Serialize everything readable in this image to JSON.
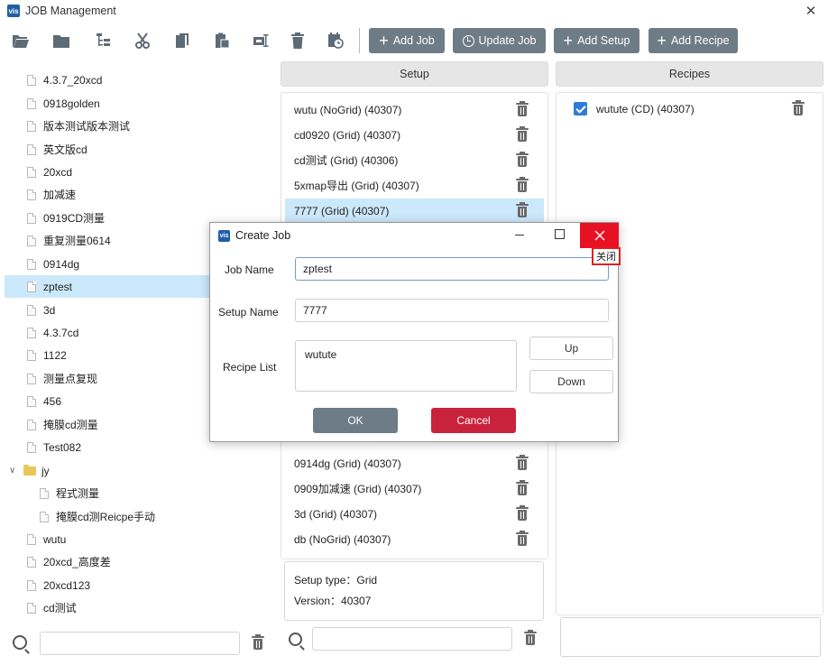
{
  "window": {
    "app_icon_text": "vis",
    "title": "JOB Management",
    "close_glyph": "✕"
  },
  "toolbar": {
    "icons": [
      "open-folder-icon",
      "folder-icon",
      "tree-structure-icon",
      "cut-icon",
      "copy-icon",
      "paste-icon",
      "rename-icon",
      "delete-icon",
      "schedule-icon"
    ],
    "buttons": {
      "add_job": "Add Job",
      "update_job": "Update Job",
      "add_setup": "Add Setup",
      "add_recipe": "Add Recipe"
    }
  },
  "tree": {
    "items": [
      {
        "label": "4.3.7_20xcd"
      },
      {
        "label": "0918golden"
      },
      {
        "label": "版本测试版本测试"
      },
      {
        "label": "英文版cd"
      },
      {
        "label": "20xcd"
      },
      {
        "label": "加减速"
      },
      {
        "label": "0919CD测量"
      },
      {
        "label": "重复测量0614"
      },
      {
        "label": "0914dg"
      },
      {
        "label": "zptest",
        "selected": true
      },
      {
        "label": "3d"
      },
      {
        "label": "4.3.7cd"
      },
      {
        "label": "1122"
      },
      {
        "label": "测量点复现"
      },
      {
        "label": "456"
      },
      {
        "label": "掩膜cd测量"
      },
      {
        "label": "Test082"
      },
      {
        "label": "jy",
        "folder": true
      },
      {
        "label": "程式测量",
        "child": true
      },
      {
        "label": "掩膜cd测Reicpe手动",
        "child": true
      },
      {
        "label": "wutu"
      },
      {
        "label": "20xcd_高度差"
      },
      {
        "label": "20xcd123"
      },
      {
        "label": "cd测试"
      }
    ]
  },
  "setup": {
    "header": "Setup",
    "items_top": [
      "wutu  (NoGrid) (40307)",
      "cd0920 (Grid) (40307)",
      "cd测试 (Grid) (40306)",
      "5xmap导出 (Grid) (40307)",
      "7777 (Grid) (40307)"
    ],
    "selected_index": 4,
    "items_bottom": [
      "0914dg (Grid) (40307)",
      "0909加减速 (Grid) (40307)",
      "3d (Grid) (40307)",
      "db (NoGrid) (40307)"
    ],
    "info": {
      "type_label": "Setup type：Grid",
      "version_label": "Version：40307"
    }
  },
  "recipes": {
    "header": "Recipes",
    "items": [
      {
        "label": "wutute (CD) (40307)",
        "checked": true
      }
    ]
  },
  "dialog": {
    "icon_text": "vis",
    "title": "Create Job",
    "close_tooltip": "关闭",
    "job_name_label": "Job Name",
    "job_name_value": "zptest",
    "setup_name_label": "Setup Name",
    "setup_name_value": "7777",
    "recipe_list_label": "Recipe List",
    "recipe_list_items": [
      "wutute"
    ],
    "up_button": "Up",
    "down_button": "Down",
    "ok_button": "OK",
    "cancel_button": "Cancel"
  },
  "colors": {
    "toolbar_button": "#6d7c87",
    "selection": "#cce8fb",
    "cancel": "#c8223c",
    "close_hover": "#e81123",
    "checkbox": "#2f7cd6"
  }
}
